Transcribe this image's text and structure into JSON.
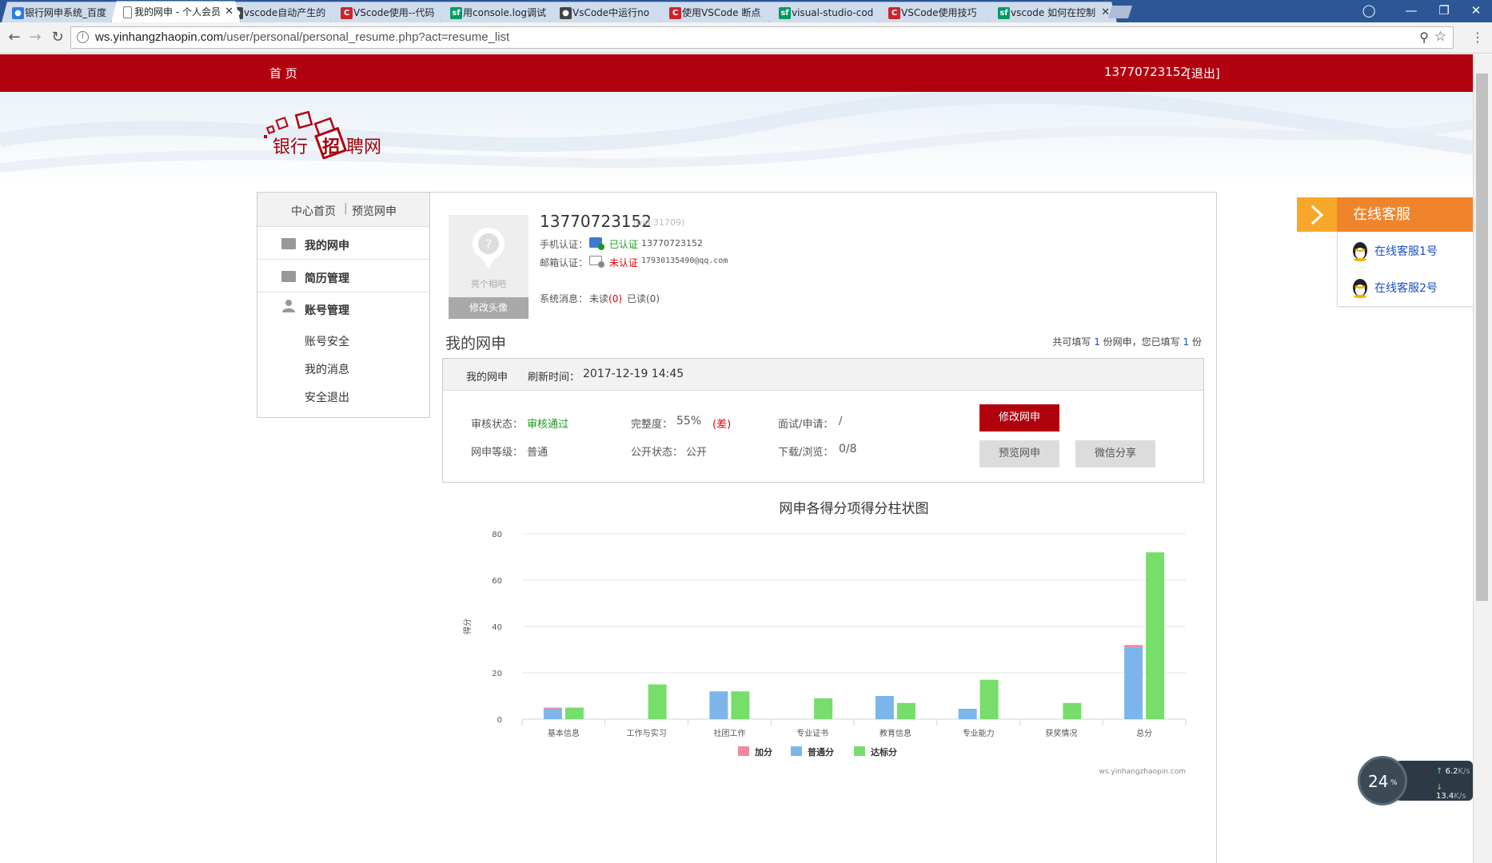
{
  "browser": {
    "tabs": [
      {
        "title": "银行网申系统_百度",
        "icon": "baidu-paw-icon",
        "color": "#2b7de1"
      },
      {
        "title": "我的网申 - 个人会员",
        "icon": "document-icon",
        "color": "#777777"
      },
      {
        "title": "vscode自动产生的",
        "icon": "paw-icon",
        "color": "#444444"
      },
      {
        "title": "VScode使用--代码",
        "icon": "csdn-c-icon",
        "color": "#c9252b"
      },
      {
        "title": "用console.log调试",
        "icon": "sf-icon",
        "color": "#009a61"
      },
      {
        "title": "VsCode中运行no",
        "icon": "paw-icon",
        "color": "#444444"
      },
      {
        "title": "使用VSCode 断点",
        "icon": "csdn-c-icon",
        "color": "#c9252b"
      },
      {
        "title": "visual-studio-cod",
        "icon": "sf-icon",
        "color": "#009a61"
      },
      {
        "title": "VSCode使用技巧",
        "icon": "csdn-c-icon",
        "color": "#c9252b"
      },
      {
        "title": "vscode 如何在控制",
        "icon": "sf-icon",
        "color": "#009a61"
      }
    ],
    "url_host": "ws.yinhangzhaopin.com",
    "url_path": "/user/personal/personal_resume.php?act=resume_list"
  },
  "topnav": {
    "home": "首 页",
    "phone": "13770723152",
    "logout": "[退出]"
  },
  "logo": {
    "text_left": "银行",
    "text_mid": "招",
    "text_right": "聘网"
  },
  "sidebar": {
    "tab_home": "中心首页",
    "tab_sep": "|",
    "tab_preview": "预览网申",
    "menu": [
      "我的网申",
      "简历管理",
      "账号管理"
    ],
    "sub": [
      "账号安全",
      "我的消息",
      "安全退出"
    ]
  },
  "profile": {
    "avatar_caption": "亮个相吧",
    "change_avatar": "修改头像",
    "name": "13770723152",
    "uid": "(uid:31709)",
    "phone_label": "手机认证：",
    "phone_status": "已认证",
    "phone_value": "13770723152",
    "email_label": "邮箱认证：",
    "email_status": "未认证",
    "email_value": "17930135490@qq.com",
    "msg_label": "系统消息：",
    "msg_unread": "未读",
    "msg_unread_count": "(0)",
    "msg_read": "已读(0)"
  },
  "section": {
    "title": "我的网申",
    "summary_a": "共可填写",
    "summary_total": "1",
    "summary_b": "份网申，您已填写",
    "summary_filled": "1",
    "summary_c": "份"
  },
  "resume_card": {
    "header_name": "我的网申",
    "refresh_label": "刷新时间：",
    "refresh_time": "2017-12-19 14:45",
    "review_label": "审核状态：",
    "review_value": "审核通过",
    "completeness_label": "完整度：",
    "completeness_value": "55%",
    "completeness_note": "(差)",
    "interview_label": "面试/申请：",
    "interview_value": "/",
    "level_label": "网申等级：",
    "level_value": "普通",
    "public_label": "公开状态：",
    "public_value": "公开",
    "download_label": "下载/浏览：",
    "download_value": "0/8",
    "btn_edit": "修改网申",
    "btn_preview": "预览网申",
    "btn_share": "微信分享"
  },
  "chart_data": {
    "type": "bar",
    "title": "网申各得分项得分柱状图",
    "ylabel": "得分",
    "xlabel": "",
    "ylim": [
      0,
      80
    ],
    "yticks": [
      "0",
      "20",
      "40",
      "60",
      "80"
    ],
    "categories": [
      "基本信息",
      "工作与实习",
      "社团工作",
      "专业证书",
      "教育信息",
      "专业能力",
      "获奖情况",
      "总分"
    ],
    "series": [
      {
        "name": "加分",
        "color": "#f08a9a",
        "values": [
          0.5,
          0,
          0,
          0,
          0,
          0,
          0,
          1
        ]
      },
      {
        "name": "普通分",
        "color": "#7cb5ec",
        "values": [
          4.5,
          0,
          12,
          0,
          10,
          4.5,
          0,
          31
        ]
      },
      {
        "name": "达标分",
        "color": "#77dd6b",
        "values": [
          5,
          15,
          12,
          9,
          7,
          17,
          7,
          72
        ]
      }
    ],
    "credit": "ws.yinhangzhaopin.com",
    "grid": true,
    "legend_position": "bottom"
  },
  "service": {
    "title": "在线客服",
    "items": [
      "在线客服1号",
      "在线客服2号"
    ]
  },
  "netmeter": {
    "percent": "24",
    "pct_sign": "%",
    "up": "6.2",
    "down": "13.4",
    "unit": "K/s"
  },
  "colors": {
    "brand_red": "#b1000e",
    "orange": "#f0842c",
    "green": "#1a9a1a",
    "red": "#e00000",
    "blue_link": "#1a4fc4"
  }
}
